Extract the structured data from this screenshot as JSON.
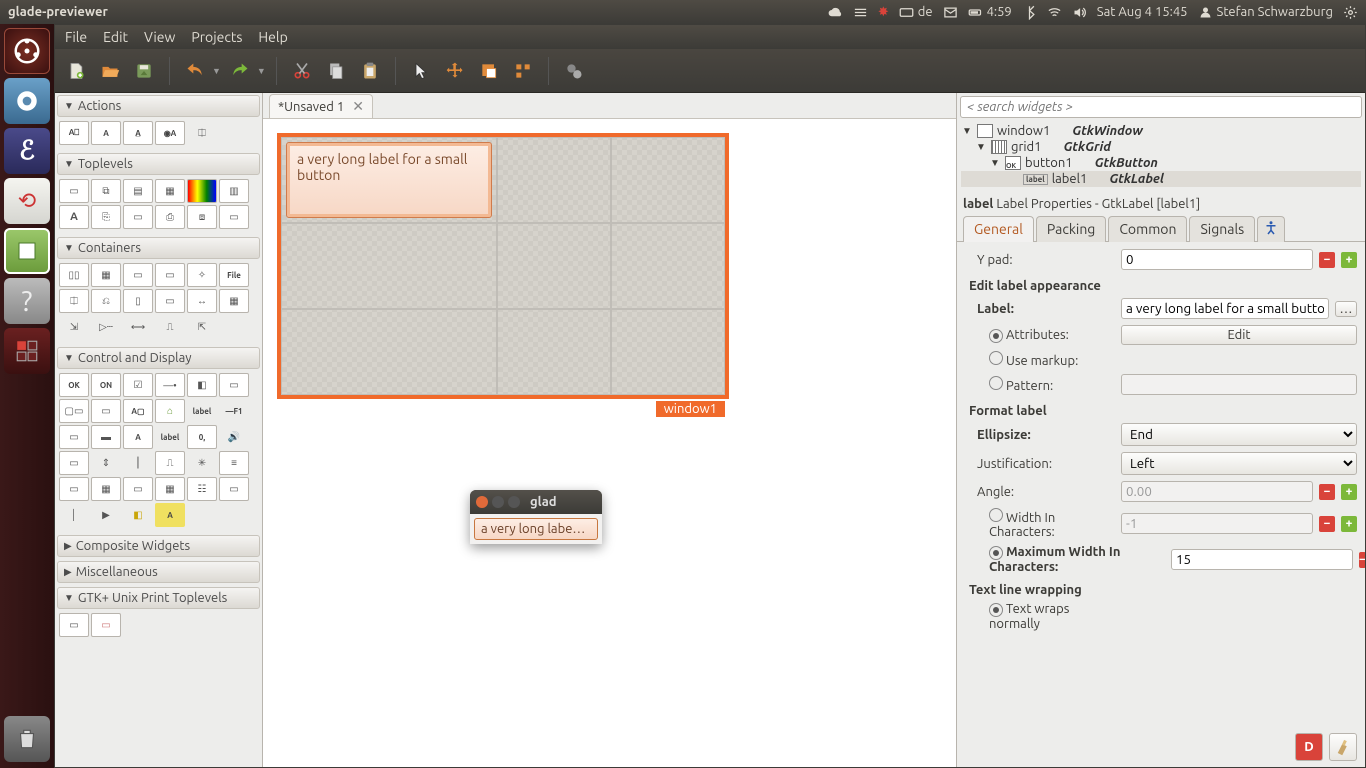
{
  "system": {
    "title": "glade-previewer",
    "kb": "de",
    "batt": "4:59",
    "date": "Sat Aug  4 15:45",
    "user": "Stefan Schwarzburg"
  },
  "menu": {
    "file": "File",
    "edit": "Edit",
    "view": "View",
    "projects": "Projects",
    "help": "Help"
  },
  "tabs": {
    "doc": "*Unsaved 1"
  },
  "palette": {
    "actions": "Actions",
    "toplevels": "Toplevels",
    "containers": "Containers",
    "control": "Control and Display",
    "composite": "Composite Widgets",
    "misc": "Miscellaneous",
    "gtkprint": "GTK+ Unix Print Toplevels"
  },
  "designer": {
    "button_label": "a very long label for a small button",
    "window_tag": "window1"
  },
  "preview": {
    "title": "glad",
    "button": "a very long labe…"
  },
  "inspector": {
    "search_ph": "< search widgets >",
    "tree": {
      "window": {
        "name": "window1",
        "type": "GtkWindow"
      },
      "grid": {
        "name": "grid1",
        "type": "GtkGrid"
      },
      "button": {
        "name": "button1",
        "type": "GtkButton"
      },
      "label": {
        "name": "label1",
        "type": "GtkLabel"
      }
    },
    "props_title_prefix": "label",
    "props_title": "Label Properties - GtkLabel [label1]",
    "tabs": {
      "general": "General",
      "packing": "Packing",
      "common": "Common",
      "signals": "Signals"
    },
    "ypad_label": "Y pad:",
    "ypad_val": "0",
    "edit_appearance": "Edit label appearance",
    "label_lab": "Label:",
    "label_val": "a very long label for a small button",
    "attributes": "Attributes:",
    "edit_btn": "Edit",
    "use_markup": "Use markup:",
    "pattern": "Pattern:",
    "format_label": "Format label",
    "ellipsize": "Ellipsize:",
    "ellipsize_val": "End",
    "justification": "Justification:",
    "justification_val": "Left",
    "angle": "Angle:",
    "angle_val": "0.00",
    "width_chars": "Width In Characters:",
    "width_chars_val": "-1",
    "max_width": "Maximum Width In Characters:",
    "max_width_val": "15",
    "wrap_head": "Text line wrapping",
    "wrap_normal": "Text wraps normally"
  }
}
